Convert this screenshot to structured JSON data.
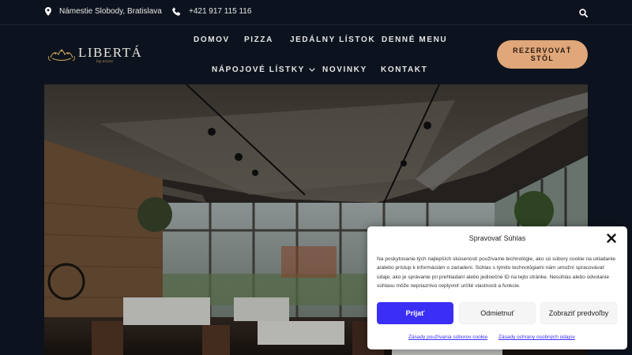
{
  "topbar": {
    "address": "Námestie Slobody, Bratislava",
    "phone": "+421 917 115 116"
  },
  "logo": {
    "name": "LIBERTÁ",
    "tagline": "by ezzzz"
  },
  "nav": {
    "items": [
      {
        "label": "DOMOV"
      },
      {
        "label": "PIZZA"
      },
      {
        "label": "JEDÁLNY LÍSTOK"
      },
      {
        "label": "DENNÉ MENU"
      },
      {
        "label": "NÁPOJOVÉ LÍSTKY"
      },
      {
        "label": "NOVINKY"
      },
      {
        "label": "KONTAKT"
      }
    ],
    "reserve_label": "REZERVOVAŤ\nSTÔL"
  },
  "consent": {
    "title": "Spravovať Súhlas",
    "description": "Na poskytovanie tých najlepších skúseností používame technológie, ako sú súbory cookie na ukladanie a/alebo prístup k informáciám o zariadení. Súhlas s týmito technológiami nám umožní spracovávať údaje, ako je správanie pri prehliadaní alebo jedinečné ID na tejto stránke. Nesúhlas alebo odvolanie súhlasu môže nepriaznivo ovplyvniť určité vlastnosti a funkcie.",
    "accept_label": "Prijať",
    "deny_label": "Odmietnuť",
    "preferences_label": "Zobraziť predvoľby",
    "cookie_policy_link": "Zásady používania súborov cookie",
    "privacy_policy_link": "Zásady ochrany osobných údajov"
  },
  "colors": {
    "background": "#0d131e",
    "reserve_button": "#e0a77a",
    "accept_button": "#3b2ef5",
    "link": "#3b2ef5"
  }
}
